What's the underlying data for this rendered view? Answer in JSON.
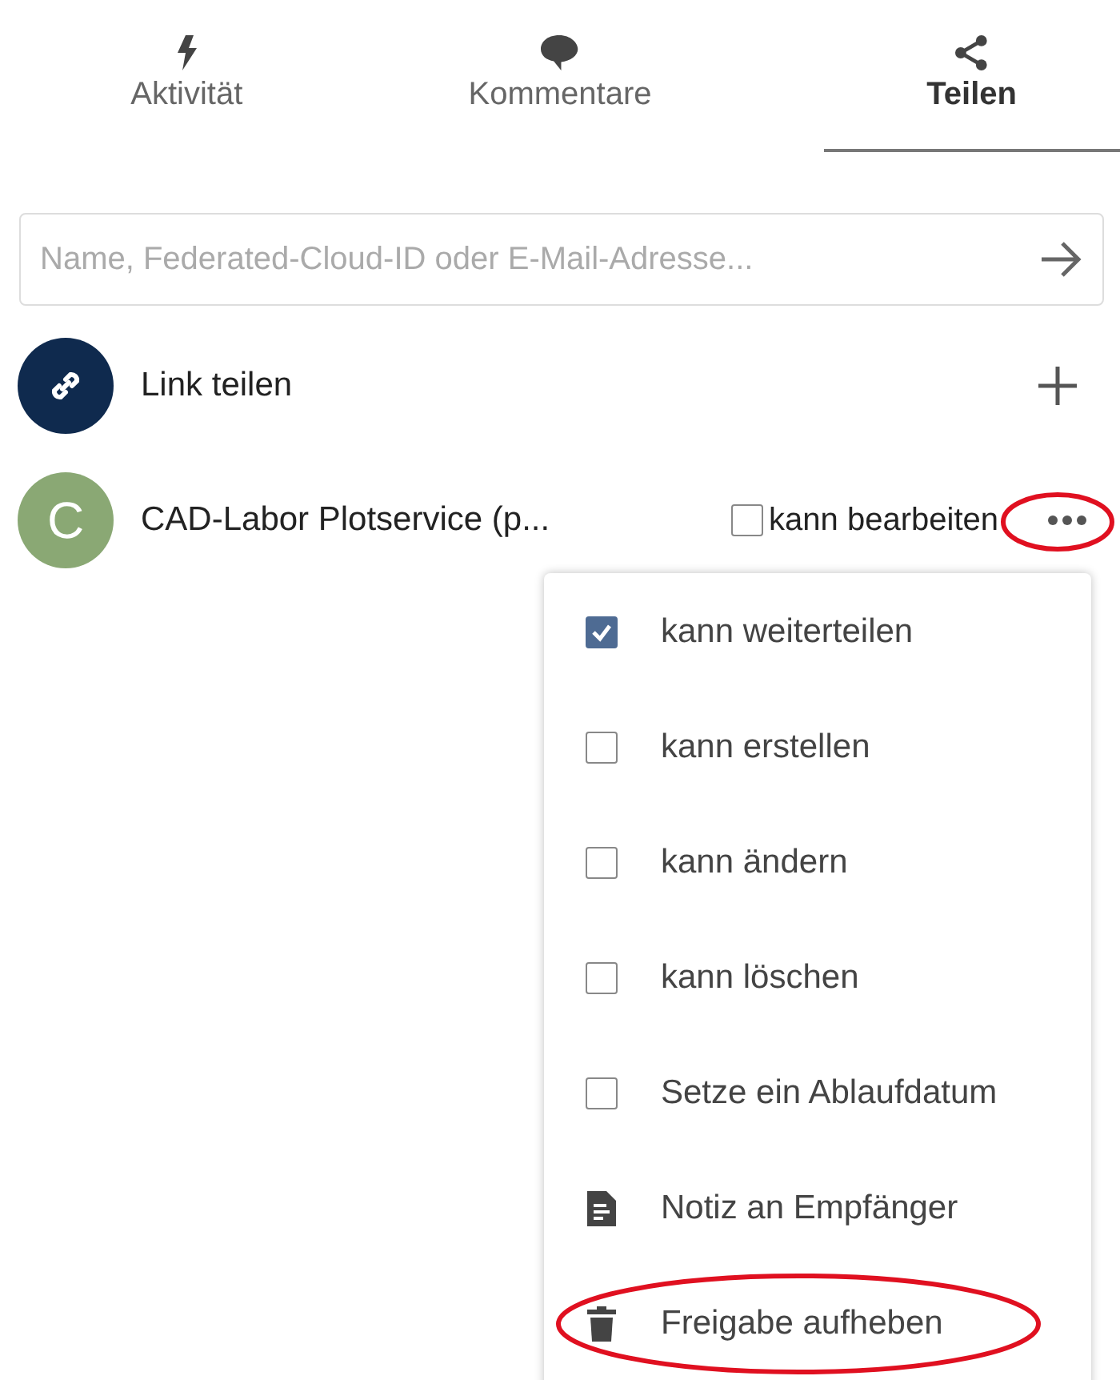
{
  "tabs": [
    {
      "label": "Aktivität",
      "selected": false
    },
    {
      "label": "Kommentare",
      "selected": false
    },
    {
      "label": "Teilen",
      "selected": true
    }
  ],
  "search": {
    "placeholder": "Name, Federated-Cloud-ID oder E-Mail-Adresse..."
  },
  "link_share": {
    "label": "Link teilen"
  },
  "share": {
    "initial": "C",
    "name": "CAD-Labor Plotservice (p...",
    "edit_label": "kann bearbeiten",
    "can_edit": false,
    "menu_open": true
  },
  "menu": [
    {
      "kind": "checkbox",
      "label": "kann weiterteilen",
      "checked": true
    },
    {
      "kind": "checkbox",
      "label": "kann erstellen",
      "checked": false
    },
    {
      "kind": "checkbox",
      "label": "kann ändern",
      "checked": false
    },
    {
      "kind": "checkbox",
      "label": "kann löschen",
      "checked": false
    },
    {
      "kind": "checkbox",
      "label": "Setze ein Ablaufdatum",
      "checked": false
    },
    {
      "kind": "note",
      "label": "Notiz an Empfänger"
    },
    {
      "kind": "delete",
      "label": "Freigabe aufheben"
    }
  ]
}
